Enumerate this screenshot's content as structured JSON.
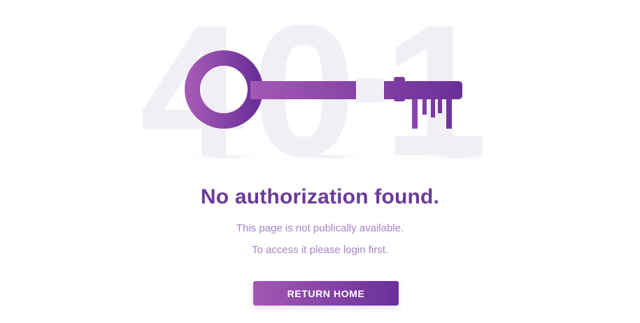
{
  "hero": {
    "error_code": "401",
    "digit_1": "4",
    "digit_2": "0",
    "digit_3": "1",
    "illustration_icon": "key-icon"
  },
  "message": {
    "heading": "No authorization found.",
    "line_1": "This page is not publically available.",
    "line_2": "To access it please login first."
  },
  "actions": {
    "return_home_label": "RETURN HOME"
  },
  "colors": {
    "accent": "#6a3a98",
    "accent_light": "#a358b5",
    "muted_text": "#a782c4",
    "digit_fill": "#f1eef6"
  }
}
